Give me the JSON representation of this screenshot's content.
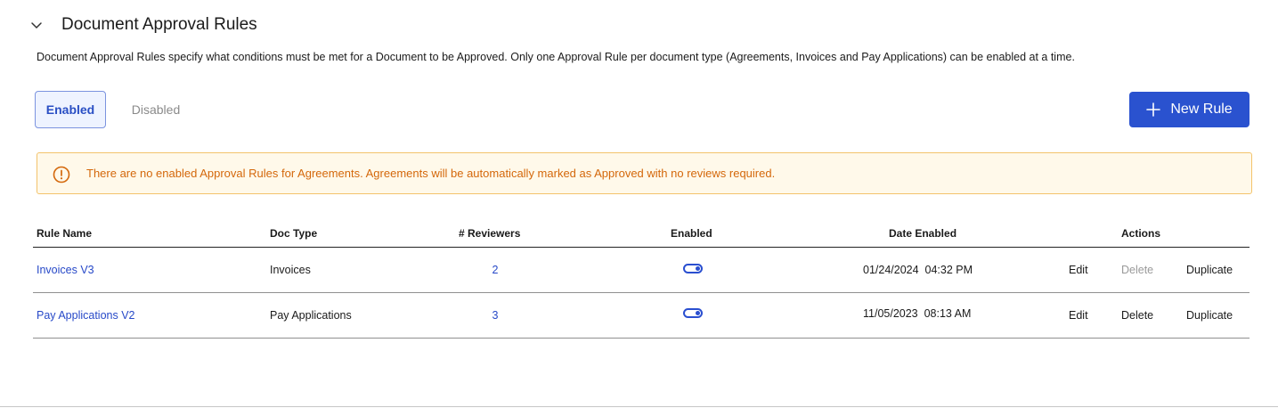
{
  "section": {
    "title": "Document Approval Rules",
    "description": "Document Approval Rules specify what conditions must be met for a Document to be Approved. Only one Approval Rule per document type (Agreements, Invoices and Pay Applications) can be enabled at a time."
  },
  "tabs": [
    {
      "label": "Enabled",
      "active": true
    },
    {
      "label": "Disabled",
      "active": false
    }
  ],
  "new_rule_button": {
    "label": "New Rule",
    "icon": "plus-icon"
  },
  "alert": {
    "icon": "warning-circle-icon",
    "text": "There are no enabled Approval Rules for Agreements. Agreements will be automatically marked as Approved with no reviews required.",
    "color": "#d4680b"
  },
  "table": {
    "columns": [
      "Rule Name",
      "Doc Type",
      "# Reviewers",
      "Enabled",
      "Date Enabled",
      "Actions"
    ],
    "rows": [
      {
        "name": "Invoices V3",
        "doc_type": "Invoices",
        "reviewers": "2",
        "enabled": true,
        "date_enabled": "01/24/2024  04:32 PM",
        "edit": "Edit",
        "delete": "Delete",
        "delete_disabled": true,
        "duplicate": "Duplicate"
      },
      {
        "name": "Pay Applications V2",
        "doc_type": "Pay Applications",
        "reviewers": "3",
        "enabled": true,
        "date_enabled": "11/05/2023  08:13 AM",
        "edit": "Edit",
        "delete": "Delete",
        "delete_disabled": false,
        "duplicate": "Duplicate"
      }
    ]
  },
  "colors": {
    "accent": "#2a52cf",
    "link": "#2749c8",
    "alert_bg": "#fff9ea",
    "alert_border": "#f3c36b"
  }
}
